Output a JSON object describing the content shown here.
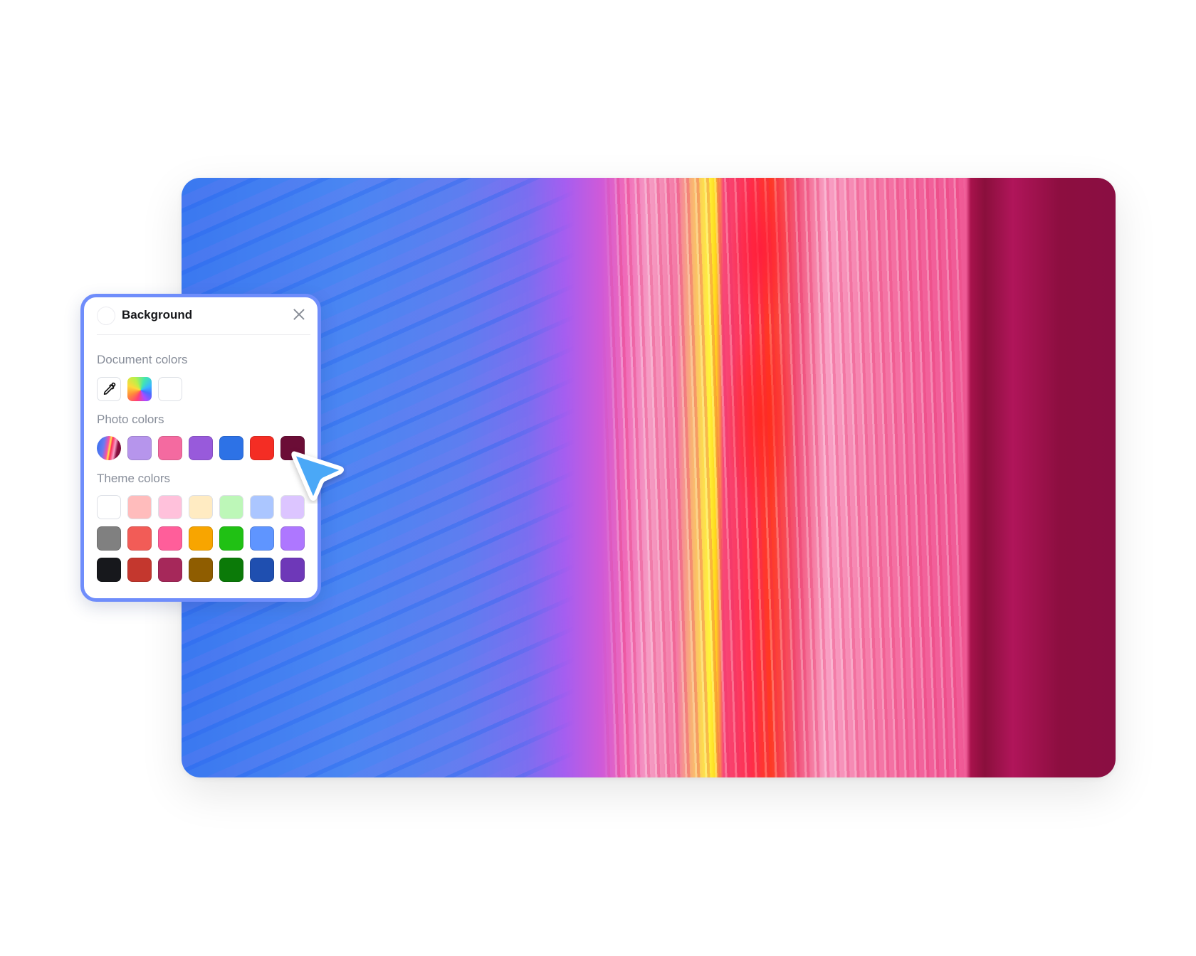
{
  "panel": {
    "title": "Background",
    "close_icon": "close-icon",
    "sections": {
      "document": {
        "label": "Document colors",
        "items": [
          {
            "type": "eyedropper",
            "icon": "eyedropper-icon"
          },
          {
            "type": "gradient",
            "name": "rainbow-gradient"
          },
          {
            "type": "color",
            "color": "#ffffff"
          }
        ]
      },
      "photo": {
        "label": "Photo colors",
        "items": [
          {
            "type": "photo-thumbnail"
          },
          {
            "type": "color",
            "color": "#b695ec"
          },
          {
            "type": "color",
            "color": "#f46aa0"
          },
          {
            "type": "color",
            "color": "#985adb"
          },
          {
            "type": "color",
            "color": "#2d72e6"
          },
          {
            "type": "color",
            "color": "#f42d24"
          },
          {
            "type": "color",
            "color": "#6b0d36"
          }
        ]
      },
      "theme": {
        "label": "Theme colors",
        "rows": [
          [
            "#ffffff",
            "#ffbcbc",
            "#ffc1db",
            "#ffebc2",
            "#bdf7b8",
            "#abc6ff",
            "#dcc5ff"
          ],
          [
            "#808080",
            "#f25c57",
            "#ff5e9a",
            "#f8a500",
            "#20c114",
            "#5f95ff",
            "#ae77ff"
          ],
          [
            "#17181c",
            "#c4372e",
            "#a6285a",
            "#8f5d00",
            "#0b7a08",
            "#1f4fb0",
            "#6e38b8"
          ]
        ]
      }
    }
  },
  "colors": {
    "panel_border": "#6f8dfb",
    "cursor": "#4aa8f7"
  }
}
